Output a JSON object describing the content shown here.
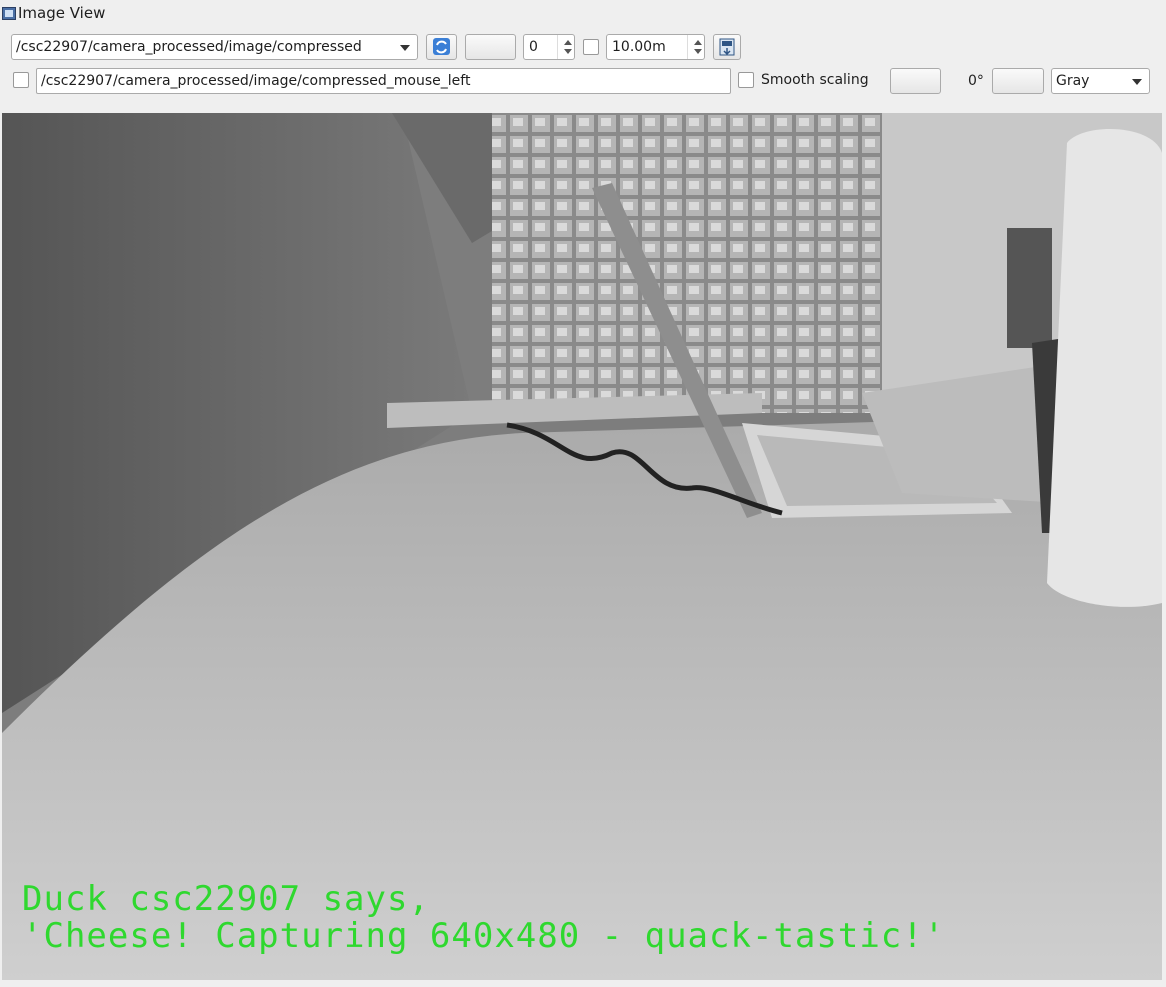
{
  "window": {
    "title": "Image View",
    "icon": "image-view-icon"
  },
  "toolbar": {
    "topic": "/csc22907/camera_processed/image/compressed",
    "refresh_icon": "refresh-icon",
    "blank_button_1": "",
    "spin_value": "0",
    "time_value": "10.00m",
    "save_icon": "save-icon",
    "mouse_topic": "/csc22907/camera_processed/image/compressed_mouse_left",
    "smooth_label": "Smooth scaling",
    "rotation": "0°",
    "colormap": "Gray"
  },
  "image": {
    "overlay_line1": "Duck csc22907 says,",
    "overlay_line2": "'Cheese! Capturing 640x480 - quack-tastic!'",
    "overlay_color": "#2fd82f"
  }
}
